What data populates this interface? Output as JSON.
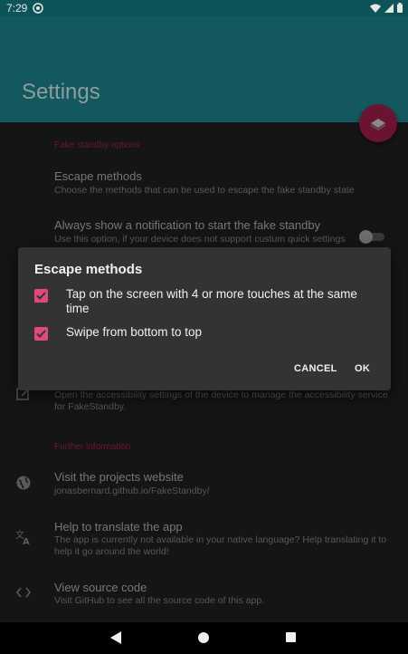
{
  "status_bar": {
    "time": "7:29"
  },
  "app_bar": {
    "title": "Settings"
  },
  "settings": {
    "category_fake_standby": "Fake standby options",
    "escape_methods_title": "Escape methods",
    "escape_methods_summary": "Choose the methods that can be used to escape the fake standby state",
    "notification_title": "Always show a notification to start the fake standby",
    "notification_summary": "Use this option, if your device does not support custum quick settings",
    "notification_switch_on": false,
    "accessibility_summary": "Open the accessibility settings of the device to manage the accessibility service for FakeStandby.",
    "category_further_info": "Further information",
    "website_title": "Visit the projects website",
    "website_summary": "jonasbernard.github.io/FakeStandby/",
    "translate_title": "Help to translate the app",
    "translate_summary": "The app is currently not available in your native language? Help translating it to help it go around the world!",
    "source_title": "View source code",
    "source_summary": "Visit GitHub to see all the source code of this app."
  },
  "dialog": {
    "title": "Escape methods",
    "options": [
      {
        "label": "Tap on the screen with 4 or more touches at the same time",
        "checked": true
      },
      {
        "label": "Swipe from bottom to top",
        "checked": true
      }
    ],
    "cancel_label": "CANCEL",
    "ok_label": "OK"
  },
  "colors": {
    "accent": "#e0497f",
    "app_bar": "#12585e",
    "fab": "#6a1333"
  },
  "icons": {
    "fab": "layers-icon",
    "accessibility": "edit-icon",
    "website": "globe-icon",
    "translate": "translate-icon",
    "source": "code-icon"
  }
}
